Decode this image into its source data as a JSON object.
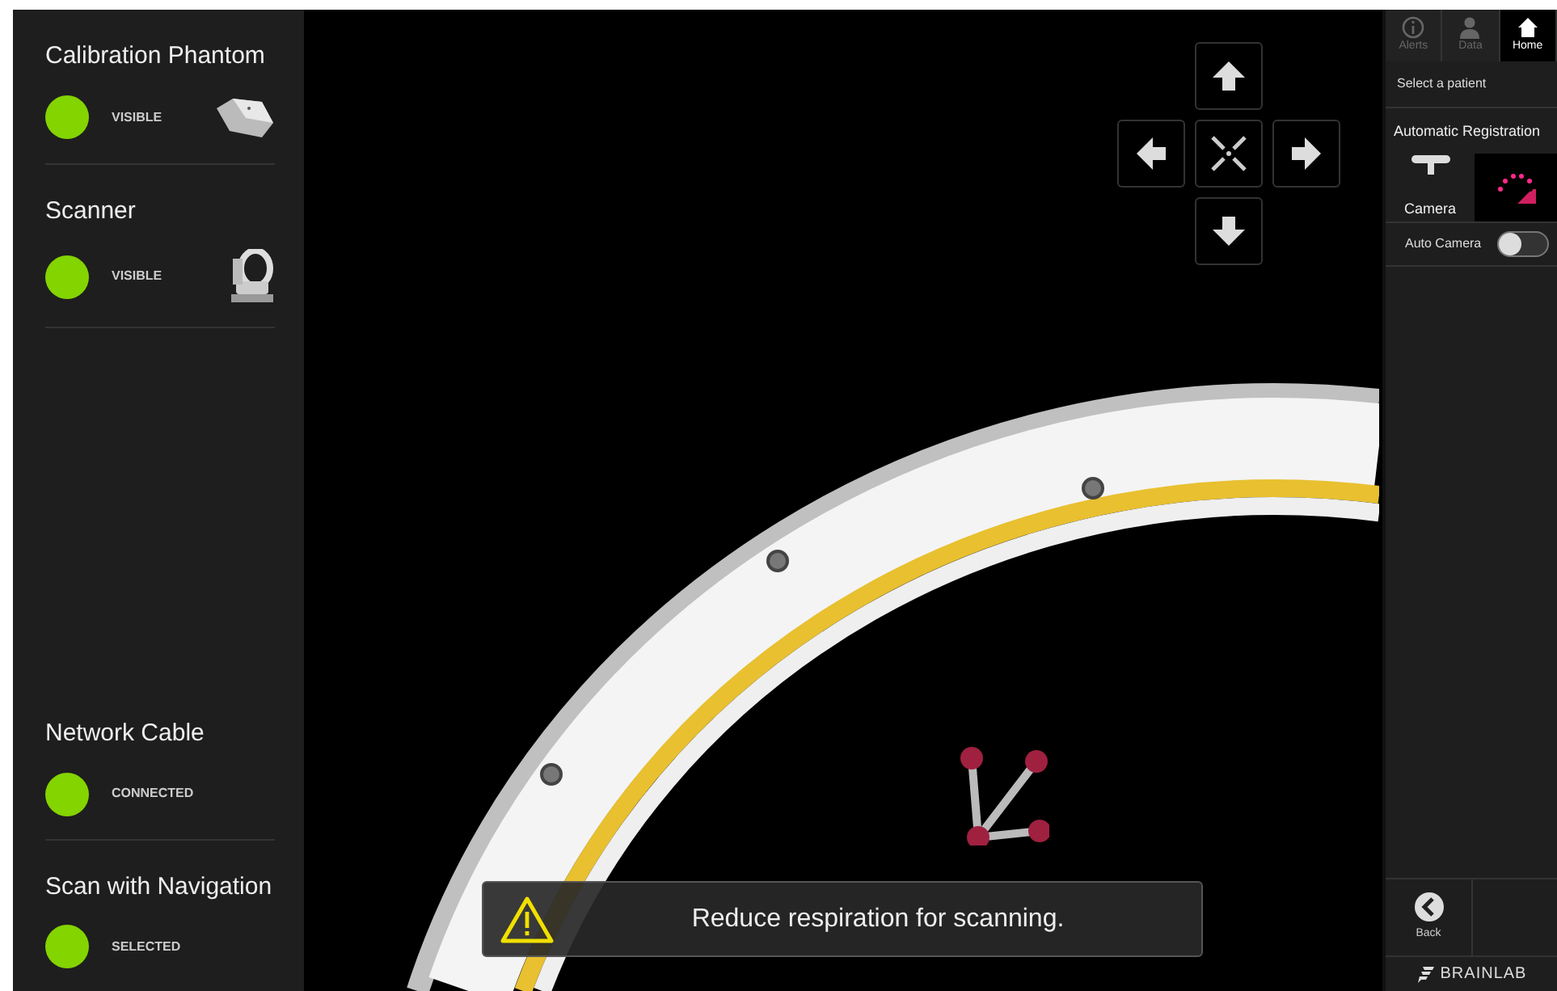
{
  "devices": [
    {
      "title": "Calibration Phantom",
      "status": "VISIBLE",
      "color": "#84d400",
      "kind": "phantom"
    },
    {
      "title": "Scanner",
      "status": "VISIBLE",
      "color": "#84d400",
      "kind": "scanner"
    },
    {
      "title": "Network Cable",
      "status": "CONNECTED",
      "color": "#84d400",
      "kind": "plain"
    },
    {
      "title": "Scan with Navigation",
      "status": "SELECTED",
      "color": "#84d400",
      "kind": "plain"
    }
  ],
  "nav_tabs": [
    {
      "label": "Alerts",
      "kind": "alerts",
      "selected": false
    },
    {
      "label": "Data",
      "kind": "data",
      "selected": false
    },
    {
      "label": "Home",
      "kind": "home",
      "selected": true
    }
  ],
  "patient_link": "Select a patient",
  "section_title": "Automatic Registration",
  "camera_label": "Camera",
  "auto_camera": {
    "label": "Auto Camera",
    "on": false
  },
  "back_label": "Back",
  "brand": "BRAINLAB",
  "message": "Reduce respiration for scanning."
}
